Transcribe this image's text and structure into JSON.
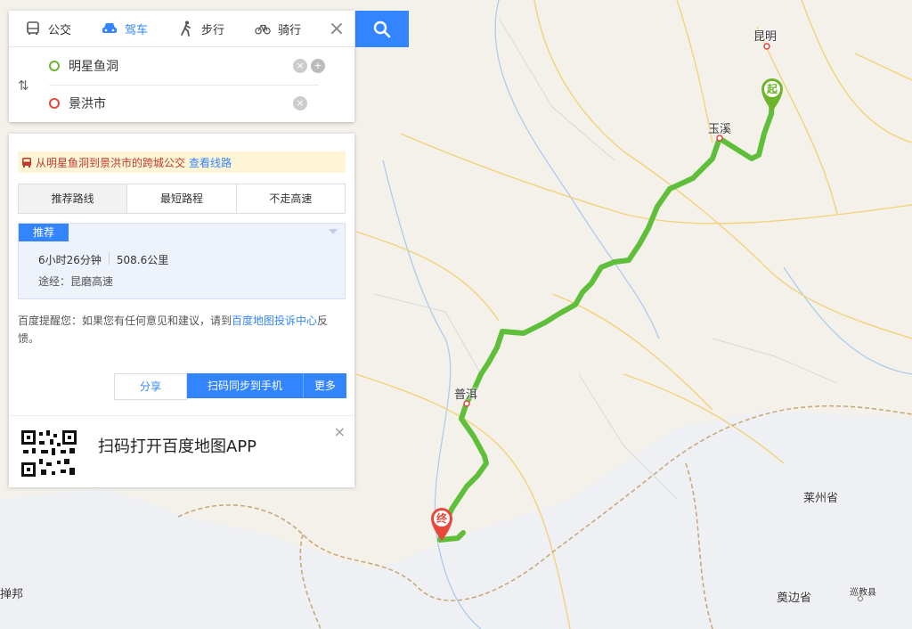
{
  "mode_tabs": [
    {
      "label": "公交",
      "icon": "bus-icon"
    },
    {
      "label": "驾车",
      "icon": "car-icon"
    },
    {
      "label": "步行",
      "icon": "walk-icon"
    },
    {
      "label": "骑行",
      "icon": "bike-icon"
    }
  ],
  "route": {
    "origin": "明星鱼洞",
    "destination": "景洪市"
  },
  "transit_tip": {
    "text": "从明星鱼洞到景洪市的跨城公交",
    "link": "查看线路"
  },
  "route_tabs": [
    "推荐路线",
    "最短路程",
    "不走高速"
  ],
  "recommended": {
    "badge": "推荐",
    "duration": "6小时26分钟",
    "distance": "508.6公里",
    "via": "途经：昆磨高速"
  },
  "notice": {
    "prefix": "百度提醒您：如果您有任何意见和建议，请到",
    "link": "百度地图投诉中心",
    "suffix": "反馈。"
  },
  "actions": {
    "share": "分享",
    "scan": "扫码同步到手机",
    "more": "更多"
  },
  "app_promo": "扫码打开百度地图APP",
  "map_labels": {
    "kunming": "昆明",
    "yuxi": "玉溪",
    "puer": "普洱",
    "laizhou": "莱州省",
    "dianbian": "奠边省",
    "xunjiao": "巡教县",
    "shanbang": "掸邦"
  },
  "markers": {
    "start": "起",
    "end": "终"
  },
  "colors": {
    "accent": "#3385ff",
    "route": "#5fbf3a",
    "start_marker": "#6fb52c",
    "end_marker": "#e8473b"
  }
}
